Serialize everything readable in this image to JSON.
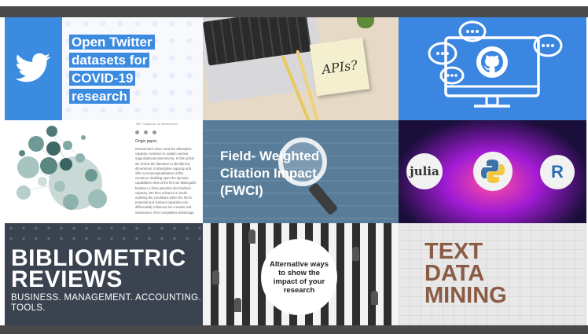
{
  "colors": {
    "twitter_blue": "#3b8be0",
    "github_blue": "#3a86e0",
    "fwci_slate": "#597d99",
    "biblio_dark": "#3b4350",
    "tdm_brown": "#8a5b45"
  },
  "tiles": {
    "twitter": {
      "icon": "twitter-bird-icon",
      "title_lines": [
        "Open Twitter",
        "datasets for",
        "COVID-19",
        "research"
      ]
    },
    "apis": {
      "note_text": "APIs?"
    },
    "github": {
      "icon": "github-octocat-icon",
      "decoration": "speech-bubbles-icon"
    },
    "origin_paper": {
      "header": "TAT? Citations, 44 References",
      "label": "Origin paper",
      "body": "Researchers have used the absorptive capacity construct to explain various organizational phenomena. In this article we review the literature to identify key dimensions of absorptive capacity and offer a reconceptualization of this construct. Building upon the dynamic capabilities view of the firm we distinguish between a firms potential and realized capacity. We then advance a model outlining the conditions when the firm's potential and realized capacities can differentially influence the creation and sustenance of its competitive advantage."
    },
    "fwci": {
      "title_lines": [
        "Field- Weighted",
        "Citation Impact",
        "(FWCI)"
      ]
    },
    "languages": {
      "items": [
        "julia",
        "python",
        "R"
      ]
    },
    "bibliometric": {
      "title_lines": [
        "BIBLIOMETRIC",
        "REVIEWS"
      ],
      "subtitle_lines": [
        "BUSINESS. MANAGEMENT. ACCOUNTING.",
        "TOOLS."
      ]
    },
    "alternative": {
      "text": "Alternative ways to show the impact of your research"
    },
    "text_data_mining": {
      "lines": [
        "TEXT",
        "DATA",
        "MINING"
      ]
    }
  }
}
